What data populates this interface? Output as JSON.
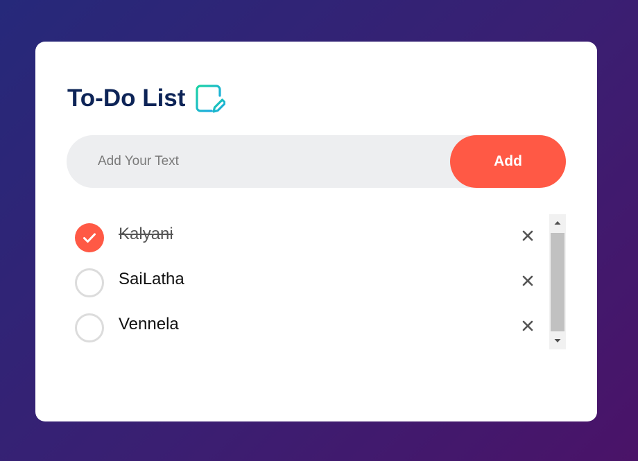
{
  "app": {
    "title": "To-Do List",
    "title_icon": "notepad-edit-icon"
  },
  "input": {
    "placeholder": "Add Your Text",
    "value": ""
  },
  "add_button": {
    "label": "Add"
  },
  "tasks": [
    {
      "text": "Kalyani",
      "checked": true
    },
    {
      "text": "SaiLatha",
      "checked": false
    },
    {
      "text": "Vennela",
      "checked": false
    }
  ],
  "icons": {
    "check": "checkmark-icon",
    "remove": "close-icon",
    "scroll_up": "arrow-up-icon",
    "scroll_down": "arrow-down-icon"
  },
  "colors": {
    "accent": "#ff5945",
    "title": "#0d2457",
    "input_bg": "#edeef0",
    "bg_gradient_start": "#26297a",
    "bg_gradient_end": "#4a1368"
  }
}
